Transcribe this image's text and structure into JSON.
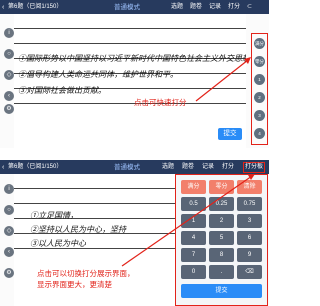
{
  "panel_one": {
    "topbar": {
      "back": "‹",
      "title": "第6题（已阅1/150）",
      "center": "普通模式",
      "nav": [
        "选题",
        "题卷",
        "记录",
        "打分"
      ],
      "sort": "⊂"
    },
    "left_tools": [
      "i",
      "○",
      "◇",
      "‹",
      "⚙"
    ],
    "handwriting": [
      "①国际形势以中国坚持以习近平新时代中国特色社会主义外交思想",
      "②倡导构建人类命运共同体，维护世界和平。",
      "③对国际社会做出贡献。"
    ],
    "quick_scores": [
      "满分",
      "零分",
      "1",
      "2",
      "3",
      "4"
    ],
    "annotation": "点击可快速打分",
    "submit": "提交"
  },
  "panel_two": {
    "topbar": {
      "back": "‹",
      "title": "第6题（已阅1/150）",
      "center": "普通模式",
      "nav": [
        "选题",
        "题卷",
        "记录",
        "打分",
        "打分板"
      ]
    },
    "left_tools": [
      "i",
      "○",
      "◇",
      "‹",
      "⚙"
    ],
    "handwriting": [
      "①立足国情，",
      "②坚持以人民为中心，坚持",
      "③以人民为中心"
    ],
    "keypad": {
      "top_row": [
        "满分",
        "零分",
        "清除"
      ],
      "rows": [
        [
          "0.5",
          "0.25",
          "0.75"
        ],
        [
          "1",
          "2",
          "3"
        ],
        [
          "4",
          "5",
          "6"
        ],
        [
          "7",
          "8",
          "9"
        ],
        [
          "0",
          ".",
          "⌫"
        ]
      ],
      "submit": "提交"
    },
    "annotation_lines": [
      "点击可以切换打分展示界面，",
      "显示界面更大，更清楚"
    ]
  },
  "colors": {
    "accent": "#e2231a",
    "topbar": "#273a5e",
    "submit": "#2a8cf7"
  }
}
